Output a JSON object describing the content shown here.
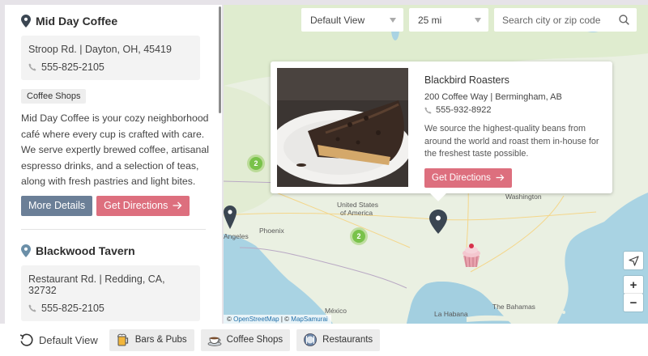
{
  "sidebar": {
    "locations": [
      {
        "name": "Mid Day Coffee",
        "address": "Stroop Rd. | Dayton, OH, 45419",
        "phone": "555-825-2105",
        "category": "Coffee Shops",
        "description": "Mid Day Coffee is your cozy neighborhood café where every cup is crafted with care. We serve expertly brewed coffee, artisanal espresso drinks, and a selection of teas, along with fresh pastries and light bites.",
        "more_label": "More Details",
        "directions_label": "Get Directions"
      },
      {
        "name": "Blackwood Tavern",
        "address": "Restaurant Rd. | Redding, CA, 32732",
        "phone": "555-825-2105"
      }
    ]
  },
  "map": {
    "view_select": "Default View",
    "radius_select": "25 mi",
    "search_placeholder": "Search city or zip code",
    "places": {
      "washington": "Washington",
      "us": "United States",
      "of_america": "of America",
      "angeles": "Angeles",
      "phoenix": "Phoenix",
      "mexico": "México",
      "la_habana": "La Habana",
      "bahamas": "The Bahamas"
    },
    "clusters": [
      "2",
      "2"
    ],
    "popup": {
      "title": "Blackbird Roasters",
      "address": "200 Coffee Way | Bermingham, AB",
      "phone": "555-932-8922",
      "description": "We source the highest-quality beans from around the world and roast them in-house for the freshest taste possible.",
      "directions_label": "Get Directions"
    },
    "zoom_in": "+",
    "zoom_out": "−",
    "attribution": {
      "copy1": "©",
      "osm": "OpenStreetMap",
      "sep": "| ©",
      "mapsamurai": "MapSamurai"
    }
  },
  "bottom_bar": {
    "default_view": "Default View",
    "chips": [
      "Bars & Pubs",
      "Coffee Shops",
      "Restaurants"
    ]
  },
  "colors": {
    "accent_red": "#dd6f7e",
    "accent_slate": "#6b7f97",
    "pin_dark": "#3b4652",
    "cluster_green": "#79c24a"
  }
}
